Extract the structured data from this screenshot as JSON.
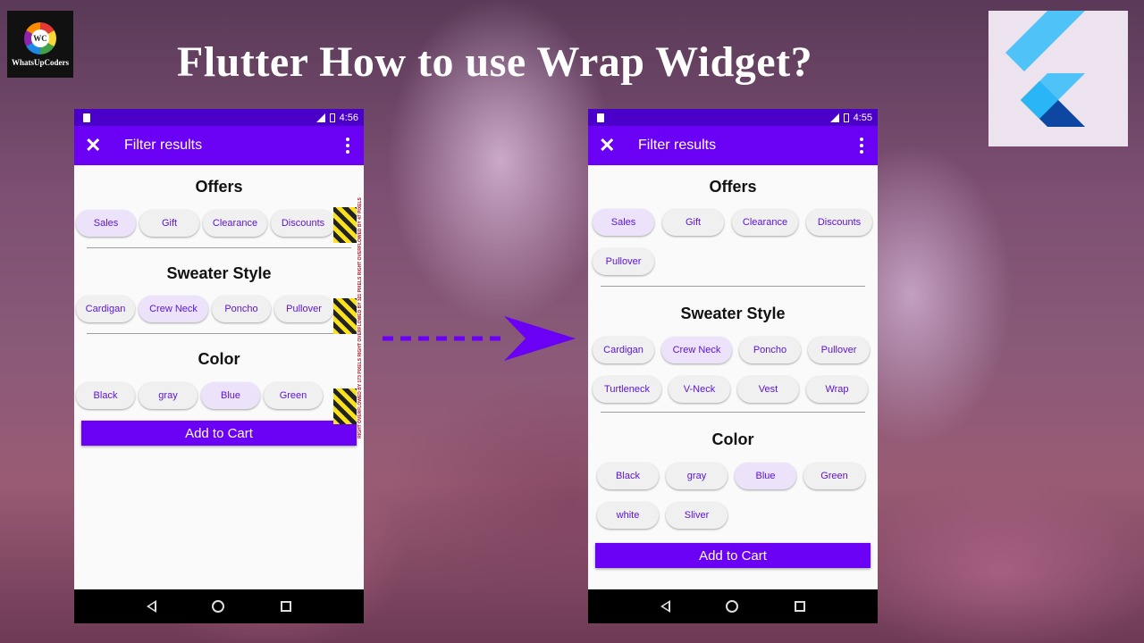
{
  "logo": {
    "badge": "WC",
    "name": "WhatsUpCoders"
  },
  "headline": "Flutter How to use Wrap Widget?",
  "flutter_logo_icon": "flutter-logo",
  "colors": {
    "primary": "#6a00f4",
    "status_bar": "#4a00c8",
    "chip_text": "#5a12d8",
    "overflow_stripe": "#f9e11c"
  },
  "left_phone": {
    "time": "4:56",
    "app_title": "Filter results",
    "offers_title": "Offers",
    "offers": [
      "Sales",
      "Gift",
      "Clearance",
      "Discounts"
    ],
    "sweater_title": "Sweater Style",
    "sweaters": [
      "Cardigan",
      "Crew Neck",
      "Poncho",
      "Pullover"
    ],
    "color_title": "Color",
    "colors": [
      "Black",
      "gray",
      "Blue",
      "Green"
    ],
    "overflow_text": "RIGHT OVERFLOWED BY 173 PIXELS   RIGHT OVERFLOWED BY 321 PIXELS   RIGHT OVERFLOWED BY 47 PIXELS",
    "button": "Add to Cart"
  },
  "right_phone": {
    "time": "4:55",
    "app_title": "Filter results",
    "offers_title": "Offers",
    "offers": [
      "Sales",
      "Gift",
      "Clearance",
      "Discounts",
      "Pullover"
    ],
    "sweater_title": "Sweater Style",
    "sweaters": [
      "Cardigan",
      "Crew Neck",
      "Poncho",
      "Pullover",
      "Turtleneck",
      "V-Neck",
      "Vest",
      "Wrap"
    ],
    "color_title": "Color",
    "colors": [
      "Black",
      "gray",
      "Blue",
      "Green",
      "white",
      "Sliver"
    ],
    "button": "Add to Cart"
  }
}
